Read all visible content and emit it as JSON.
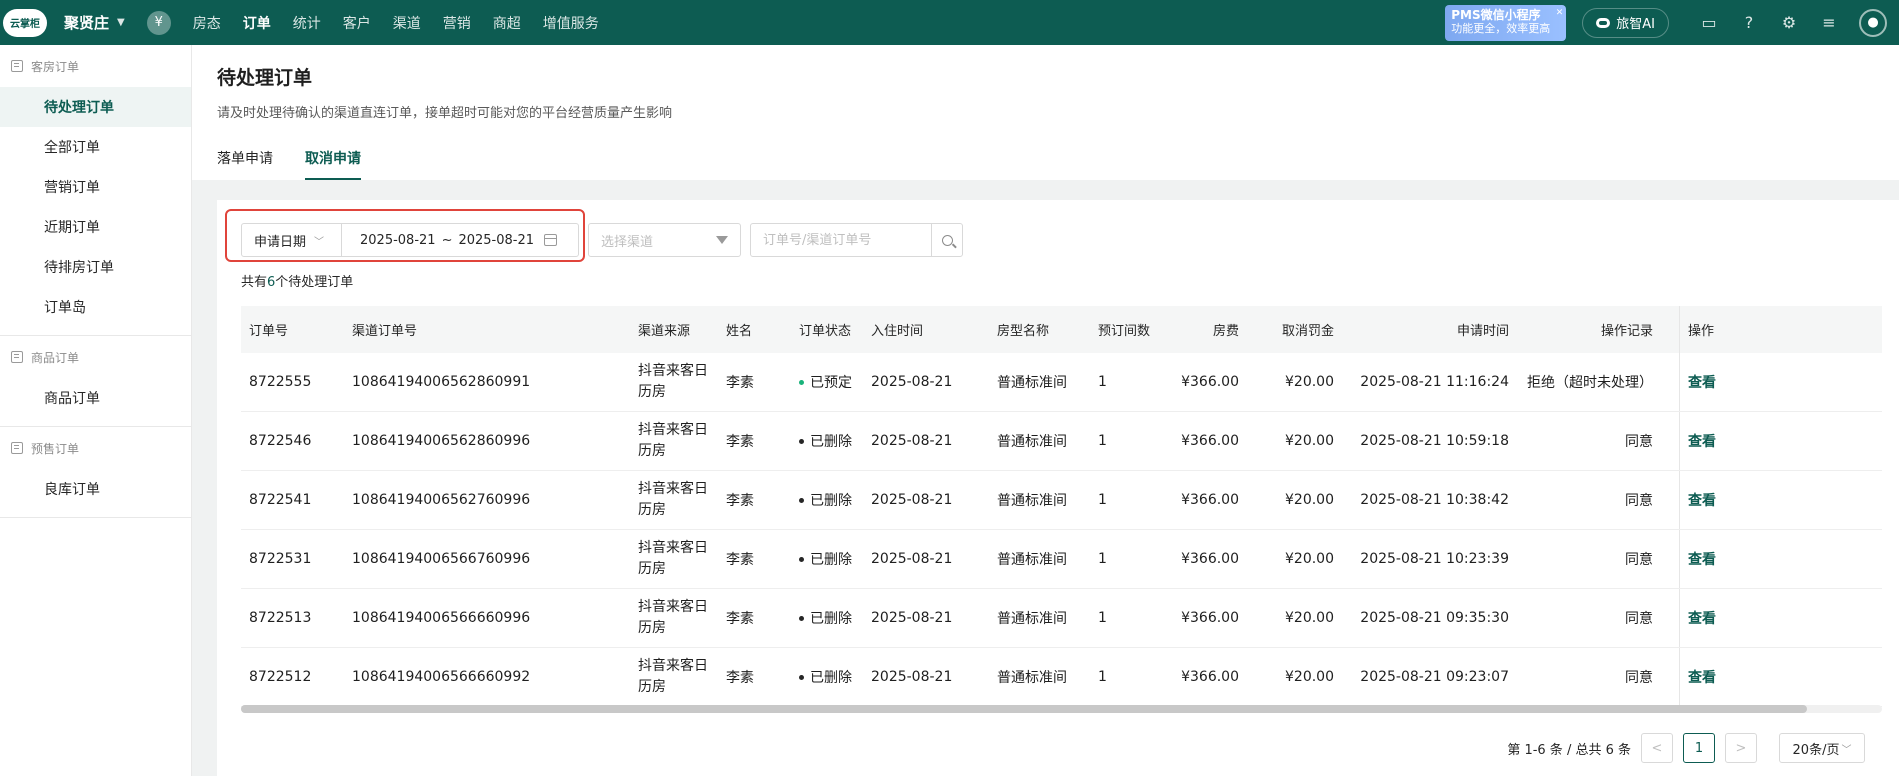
{
  "topbar": {
    "logo_text": "云掌柜",
    "hotel_name": "聚贤庄",
    "nav": [
      "房态",
      "订单",
      "统计",
      "客户",
      "渠道",
      "营销",
      "商超",
      "增值服务"
    ],
    "active_nav": "订单",
    "pms_line1": "PMS微信小程序",
    "pms_line2": "功能更全，效率更高",
    "ai_label": "旅智AI"
  },
  "sidebar": {
    "groups": [
      {
        "title": "客房订单",
        "items": [
          "待处理订单",
          "全部订单",
          "营销订单",
          "近期订单",
          "待排房订单",
          "订单岛"
        ]
      },
      {
        "title": "商品订单",
        "items": [
          "商品订单"
        ]
      },
      {
        "title": "预售订单",
        "items": [
          "良库订单"
        ]
      }
    ],
    "active_item": "待处理订单"
  },
  "page": {
    "title": "待处理订单",
    "description": "请及时处理待确认的渠道直连订单，接单超时可能对您的平台经营质量产生影响",
    "tabs": [
      "落单申请",
      "取消申请"
    ],
    "active_tab": "取消申请"
  },
  "filters": {
    "date_type": "申请日期",
    "date_start": "2025-08-21",
    "date_sep": "~",
    "date_end": "2025-08-21",
    "channel_placeholder": "选择渠道",
    "search_placeholder": "订单号/渠道订单号"
  },
  "summary": {
    "prefix": "共有",
    "count": "6",
    "suffix": "个待处理订单"
  },
  "table": {
    "headers": [
      "订单号",
      "渠道订单号",
      "渠道来源",
      "姓名",
      "订单状态",
      "入住时间",
      "房型名称",
      "预订间数",
      "房费",
      "取消罚金",
      "申请时间",
      "操作记录",
      "操作"
    ],
    "rows": [
      {
        "order_no": "8722555",
        "channel_no": "1086419400656286099​1",
        "source": "抖音来客日历房",
        "name": "李素",
        "status": "已预定",
        "status_color": "#19b27a",
        "checkin": "2025-08-21",
        "room_type": "普通标准间",
        "rooms": "1",
        "fee": "¥366.00",
        "penalty": "¥20.00",
        "apply_time": "2025-08-21 11:16:24",
        "record": "拒绝（超时未处理）",
        "action": "查看"
      },
      {
        "order_no": "8722546",
        "channel_no": "10864194006562860996",
        "source": "抖音来客日历房",
        "name": "李素",
        "status": "已删除",
        "status_color": "#262626",
        "checkin": "2025-08-21",
        "room_type": "普通标准间",
        "rooms": "1",
        "fee": "¥366.00",
        "penalty": "¥20.00",
        "apply_time": "2025-08-21 10:59:18",
        "record": "同意",
        "action": "查看"
      },
      {
        "order_no": "8722541",
        "channel_no": "10864194006562760996",
        "source": "抖音来客日历房",
        "name": "李素",
        "status": "已删除",
        "status_color": "#262626",
        "checkin": "2025-08-21",
        "room_type": "普通标准间",
        "rooms": "1",
        "fee": "¥366.00",
        "penalty": "¥20.00",
        "apply_time": "2025-08-21 10:38:42",
        "record": "同意",
        "action": "查看"
      },
      {
        "order_no": "8722531",
        "channel_no": "10864194006566760996",
        "source": "抖音来客日历房",
        "name": "李素",
        "status": "已删除",
        "status_color": "#262626",
        "checkin": "2025-08-21",
        "room_type": "普通标准间",
        "rooms": "1",
        "fee": "¥366.00",
        "penalty": "¥20.00",
        "apply_time": "2025-08-21 10:23:39",
        "record": "同意",
        "action": "查看"
      },
      {
        "order_no": "8722513",
        "channel_no": "10864194006566660996",
        "source": "抖音来客日历房",
        "name": "李素",
        "status": "已删除",
        "status_color": "#262626",
        "checkin": "2025-08-21",
        "room_type": "普通标准间",
        "rooms": "1",
        "fee": "¥366.00",
        "penalty": "¥20.00",
        "apply_time": "2025-08-21 09:35:30",
        "record": "同意",
        "action": "查看"
      },
      {
        "order_no": "8722512",
        "channel_no": "10864194006566660992",
        "source": "抖音来客日历房",
        "name": "李素",
        "status": "已删除",
        "status_color": "#262626",
        "checkin": "2025-08-21",
        "room_type": "普通标准间",
        "rooms": "1",
        "fee": "¥366.00",
        "penalty": "¥20.00",
        "apply_time": "2025-08-21 09:23:07",
        "record": "同意",
        "action": "查看"
      }
    ]
  },
  "pagination": {
    "summary": "第 1-6 条 / 总共 6 条",
    "prev": "<",
    "current_page": "1",
    "next": ">",
    "page_size": "20条/页"
  }
}
